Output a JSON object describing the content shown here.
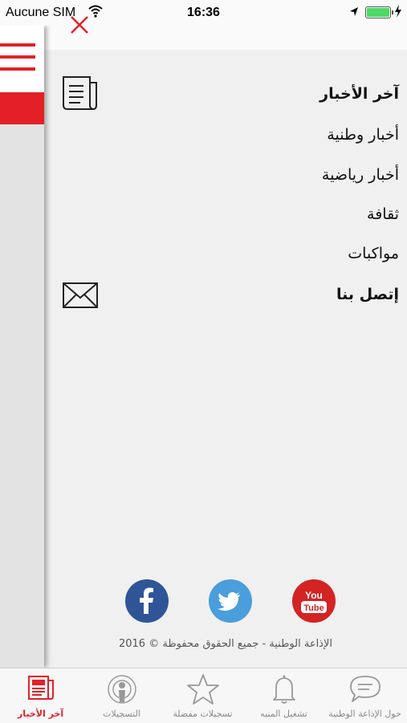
{
  "status_bar": {
    "carrier": "Aucune SIM",
    "time": "16:36"
  },
  "menu": {
    "items": [
      {
        "label": "آخر الأخبار",
        "bold": true,
        "icon": "newspaper-icon"
      },
      {
        "label": "أخبار وطنية",
        "bold": false
      },
      {
        "label": "أخبار رياضية",
        "bold": false
      },
      {
        "label": "ثقافة",
        "bold": false
      },
      {
        "label": "مواكبات",
        "bold": false
      },
      {
        "label": "إتصل بنا",
        "bold": true,
        "icon": "envelope-icon"
      }
    ]
  },
  "social": {
    "facebook_icon": "facebook-icon",
    "twitter_icon": "twitter-icon",
    "youtube_icon": "youtube-icon",
    "youtube_text_top": "You",
    "youtube_text_bottom": "Tube"
  },
  "footer": {
    "copyright": "الإذاعة الوطنية - جميع الحقوق محفوظة © 2016"
  },
  "tab_bar": {
    "tabs": [
      {
        "label": "آخر الأخبار",
        "icon": "newspaper-icon",
        "active": true
      },
      {
        "label": "التسجيلات",
        "icon": "podcast-icon",
        "active": false
      },
      {
        "label": "تسجيلات مفضلة",
        "icon": "star-icon",
        "active": false
      },
      {
        "label": "تشغيل المنبه",
        "icon": "bell-icon",
        "active": false
      },
      {
        "label": "حول الإذاعة الوطنية",
        "icon": "chat-bubble-icon",
        "active": false
      }
    ]
  },
  "colors": {
    "accent": "#e32028",
    "facebook": "#2f5597",
    "twitter": "#4a9edb",
    "youtube": "#d32323"
  }
}
